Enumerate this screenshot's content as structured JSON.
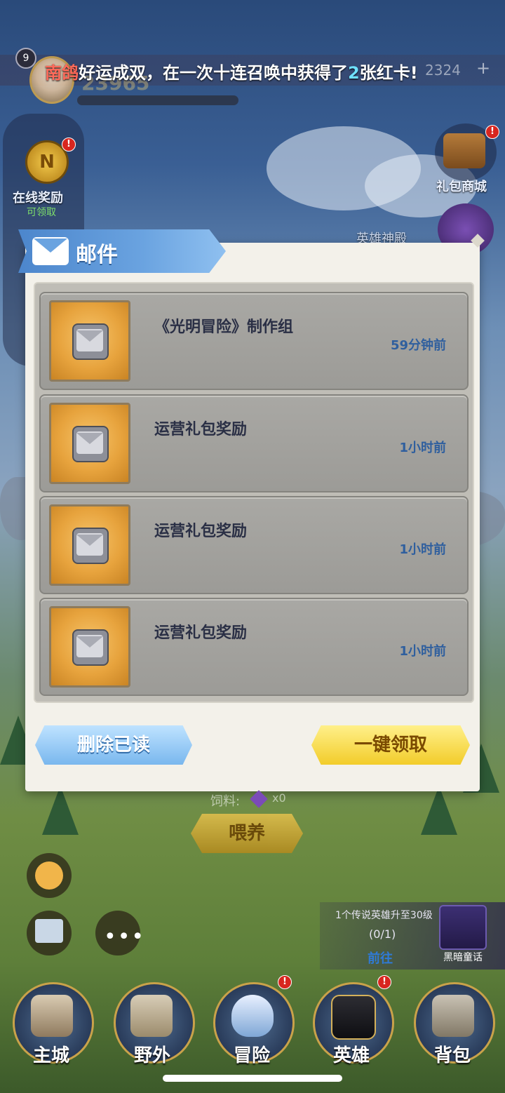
{
  "top": {
    "level": "9",
    "power": "23965",
    "announcement": {
      "player": "南鸽",
      "text_a": "好运成双，在一次十连召唤中获得了",
      "count": "2",
      "text_b": "张红卡!"
    },
    "currency": "2324"
  },
  "side": {
    "online_reward": "在线奖励",
    "online_sub": "可领取",
    "gift_shop": "礼包商城",
    "temple": "英雄神殿",
    "badge": "!"
  },
  "mail": {
    "title": "邮件",
    "items": [
      {
        "title": "《光明冒险》制作组",
        "time": "59分钟前"
      },
      {
        "title": "运营礼包奖励",
        "time": "1小时前"
      },
      {
        "title": "运营礼包奖励",
        "time": "1小时前"
      },
      {
        "title": "运营礼包奖励",
        "time": "1小时前"
      }
    ],
    "delete_read": "删除已读",
    "claim_all": "一键领取"
  },
  "scene": {
    "feed_label": "饲料:",
    "feed_count": "x0",
    "feed_button": "喂养",
    "quest_text": "1个传说英雄升至30级",
    "quest_progress": "(0/1)",
    "quest_go": "前往",
    "quest_book": "黑暗童话"
  },
  "nav": {
    "items": [
      {
        "label": "主城"
      },
      {
        "label": "野外"
      },
      {
        "label": "冒险"
      },
      {
        "label": "英雄"
      },
      {
        "label": "背包"
      }
    ]
  }
}
